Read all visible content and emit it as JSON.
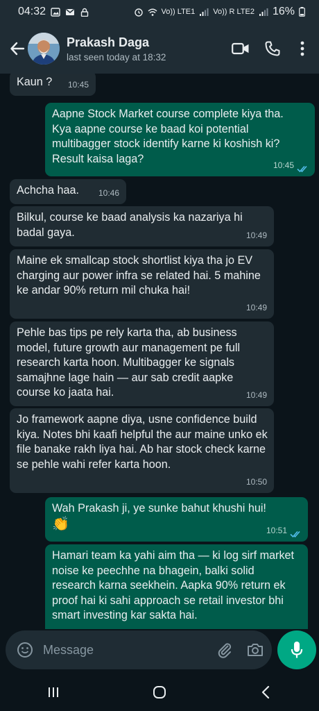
{
  "status_bar": {
    "time": "04:32",
    "battery": "16%",
    "network_1": "Vo)) LTE1",
    "network_2": "Vo)) R LTE2"
  },
  "header": {
    "contact_name": "Prakash Daga",
    "contact_status": "last seen today at 18:32"
  },
  "messages": [
    {
      "direction": "in",
      "text": "Kaun ?",
      "time": "10:45"
    },
    {
      "direction": "out",
      "text": "Aapne Stock Market course complete kiya tha. Kya aapne course ke baad koi potential multibagger stock identify karne ki koshish ki? Result kaisa laga?",
      "time": "10:45",
      "status": "read"
    },
    {
      "direction": "in",
      "text": "Achcha haa.",
      "time": "10:46"
    },
    {
      "direction": "in",
      "text": "Bilkul, course ke baad analysis ka nazariya hi badal gaya.",
      "time": "10:49"
    },
    {
      "direction": "in",
      "text": "Maine ek smallcap stock shortlist kiya tha jo EV charging aur power infra se related hai. 5 mahine ke andar 90% return mil chuka hai!",
      "time": "10:49"
    },
    {
      "direction": "in",
      "text": "Pehle bas tips pe rely karta tha, ab business model, future growth aur management pe full research karta hoon. Multibagger ke signals samajhne lage hain — aur sab credit aapke course ko jaata hai.",
      "time": "10:49"
    },
    {
      "direction": "in",
      "text": "Jo framework aapne diya, usne confidence build kiya. Notes bhi kaafi helpful the aur maine unko ek file banake rakh liya hai. Ab har stock check karne se pehle wahi refer karta hoon.",
      "time": "10:50"
    },
    {
      "direction": "out",
      "text": "Wah Prakash ji, ye sunke bahut khushi hui!",
      "emoji": "👏",
      "time": "10:51",
      "status": "read"
    },
    {
      "direction": "out",
      "text": "Hamari team ka yahi aim tha — ki log sirf market noise ke peechhe na bhagein, balki solid research karna seekhein. Aapka 90% return ek proof hai ki sahi approach se retail investor bhi smart investing kar sakta hai.",
      "time": "",
      "status": ""
    }
  ],
  "composer": {
    "placeholder": "Message"
  },
  "colors": {
    "background": "#0b141a",
    "header": "#1f2c34",
    "incoming_bubble": "#202c33",
    "outgoing_bubble": "#005c4b",
    "accent": "#00a884",
    "read_ticks": "#53bdeb"
  }
}
